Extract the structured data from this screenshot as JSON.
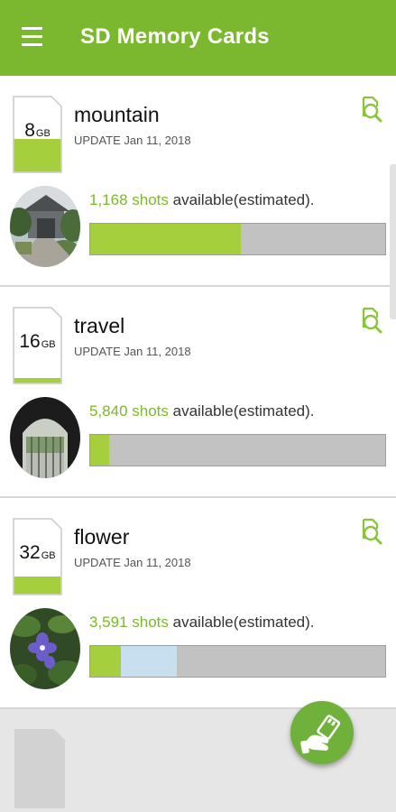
{
  "app": {
    "title": "SD Memory Cards",
    "colors": {
      "primary": "#7cb82f",
      "used": "#a6cf3d",
      "pending": "#c8dff0",
      "free": "#c2c2c2",
      "fab": "#6fb13a"
    }
  },
  "cards": [
    {
      "capacity": "8",
      "unit": "GB",
      "name": "mountain",
      "update": "UPDATE Jan 11, 2018",
      "shots_count": "1,168 shots",
      "shots_suffix": "available(estimated).",
      "used_fraction": 0.51,
      "pending_fraction": 0.0,
      "thumbnail": "temple-photo"
    },
    {
      "capacity": "16",
      "unit": "GB",
      "name": "travel",
      "update": "UPDATE Jan 11, 2018",
      "shots_count": "5,840 shots",
      "shots_suffix": "available(estimated).",
      "used_fraction": 0.065,
      "pending_fraction": 0.0,
      "thumbnail": "gate-photo"
    },
    {
      "capacity": "32",
      "unit": "GB",
      "name": "flower",
      "update": "UPDATE Jan 11, 2018",
      "shots_count": "3,591 shots",
      "shots_suffix": "available(estimated).",
      "used_fraction": 0.105,
      "pending_fraction": 0.19,
      "thumbnail": "flower-photo"
    }
  ],
  "icons": {
    "menu": "menu-icon",
    "search": "search-document-icon",
    "fab": "hand-holding-card-icon"
  }
}
